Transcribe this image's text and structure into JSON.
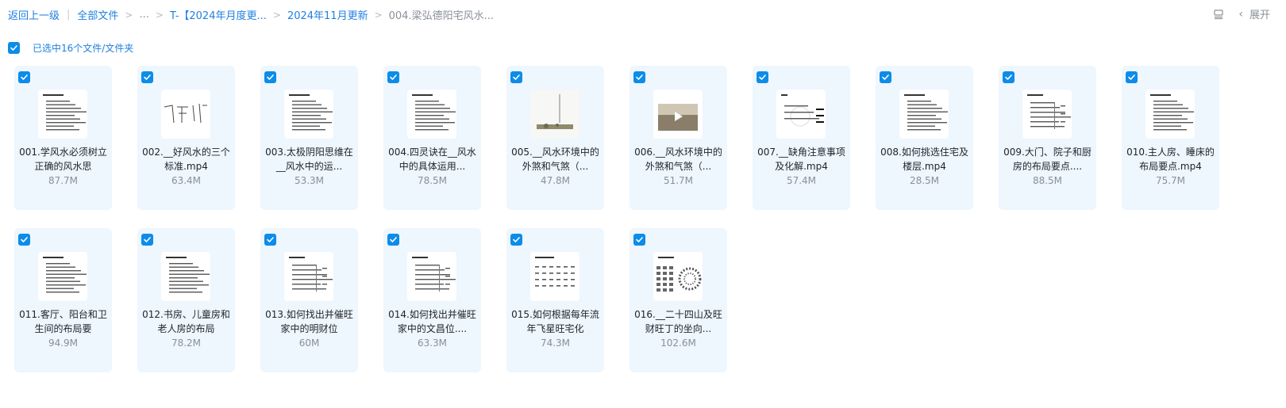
{
  "breadcrumb": {
    "back": "返回上一级",
    "all_files": "全部文件",
    "ellipsis": "...",
    "folder1": "T-【2024年月度更...",
    "folder2": "2024年11月更新",
    "current": "004.梁弘德阳宅风水..."
  },
  "toolbar": {
    "expand_label": "展开"
  },
  "selection": {
    "text": "已选中16个文件/文件夹"
  },
  "files": [
    {
      "name": "001.学风水必须树立正确的风水思",
      "size": "87.7M",
      "thumb": "doc"
    },
    {
      "name": "002.__好风水的三个标准.mp4",
      "size": "63.4M",
      "thumb": "sketch"
    },
    {
      "name": "003.太极阴阳思维在__风水中的运...",
      "size": "53.3M",
      "thumb": "doc"
    },
    {
      "name": "004.四灵诀在__风水中的具体运用...",
      "size": "78.5M",
      "thumb": "doc"
    },
    {
      "name": "005.__风水环境中的外煞和气煞（...",
      "size": "47.8M",
      "thumb": "photo1"
    },
    {
      "name": "006.__风水环境中的外煞和气煞（...",
      "size": "51.7M",
      "thumb": "photo2"
    },
    {
      "name": "007.__缺角注意事项及化解.mp4",
      "size": "57.4M",
      "thumb": "diagram"
    },
    {
      "name": "008.如何挑选住宅及楼层.mp4",
      "size": "28.5M",
      "thumb": "doc"
    },
    {
      "name": "009.大门、院子和厨房的布局要点....",
      "size": "88.5M",
      "thumb": "table"
    },
    {
      "name": "010.主人房、睡床的布局要点.mp4",
      "size": "75.7M",
      "thumb": "doc"
    },
    {
      "name": "011.客厅、阳台和卫生间的布局要",
      "size": "94.9M",
      "thumb": "doc"
    },
    {
      "name": "012.书房、儿童房和老人房的布局",
      "size": "78.2M",
      "thumb": "doc"
    },
    {
      "name": "013.如何找出并催旺家中的明财位",
      "size": "60M",
      "thumb": "table"
    },
    {
      "name": "014.如何找出并催旺家中的文昌位....",
      "size": "63.3M",
      "thumb": "table"
    },
    {
      "name": "015.如何根据每年流年飞星旺宅化",
      "size": "74.3M",
      "thumb": "grid"
    },
    {
      "name": "016.__二十四山及旺财旺丁的坐向...",
      "size": "102.6M",
      "thumb": "compass"
    }
  ]
}
